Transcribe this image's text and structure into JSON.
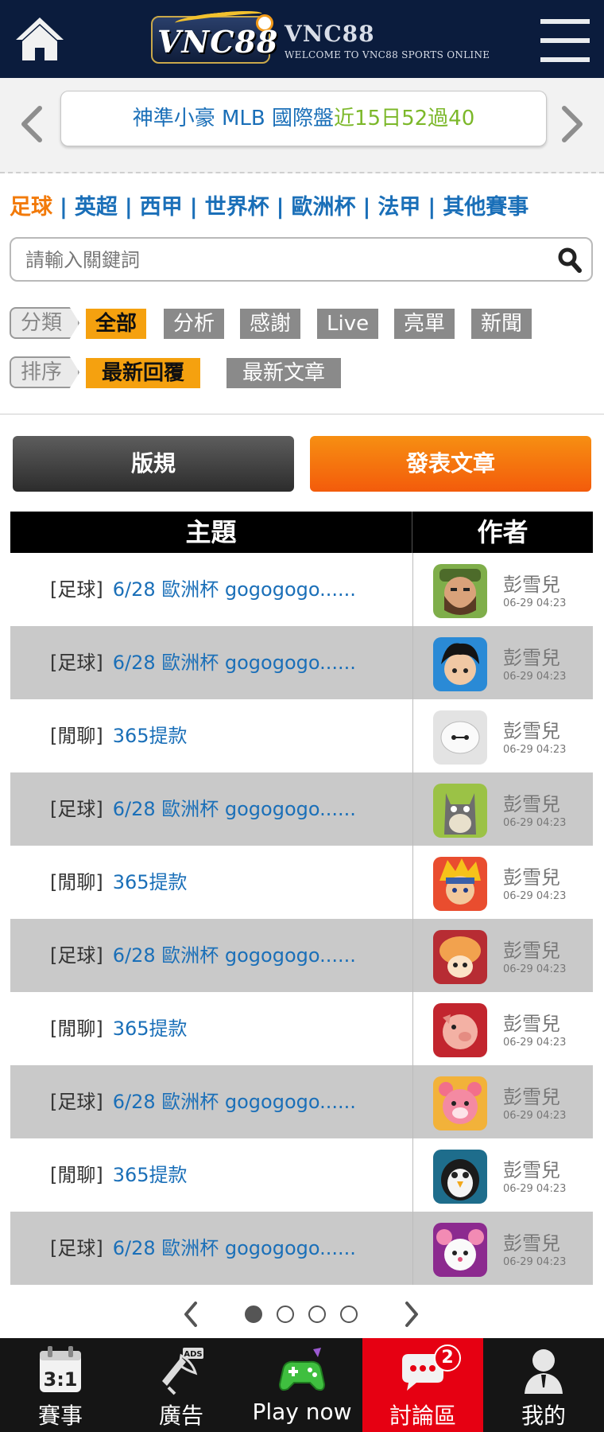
{
  "header": {
    "logo_text": "VNC88",
    "brand_name": "VNC88",
    "brand_tagline": "WELCOME TO VNC88 SPORTS ONLINE"
  },
  "marquee": {
    "part1": "神準小豪 MLB 國際盤",
    "part2": "近15日52過40"
  },
  "categories": [
    "足球",
    "英超",
    "西甲",
    "世界杯",
    "歐洲杯",
    "法甲",
    "其他賽事"
  ],
  "search": {
    "placeholder": "請輸入關鍵詞"
  },
  "filters": {
    "type_label": "分類",
    "type_options": [
      "全部",
      "分析",
      "感謝",
      "Live",
      "亮單",
      "新聞"
    ],
    "sort_label": "排序",
    "sort_options": [
      "最新回覆",
      "最新文章"
    ]
  },
  "buttons": {
    "rules": "版規",
    "post": "發表文章"
  },
  "table": {
    "headers": {
      "topic": "主題",
      "author": "作者"
    },
    "rows": [
      {
        "tag": "[足球]",
        "title": "6/28 歐洲杯 gogogogo......",
        "author": "彭雪兒",
        "date": "06-29 04:23",
        "avatar": "bearded-warrior"
      },
      {
        "tag": "[足球]",
        "title": "6/28 歐洲杯 gogogogo......",
        "author": "彭雪兒",
        "date": "06-29 04:23",
        "avatar": "black-hair-boy"
      },
      {
        "tag": "[閒聊]",
        "title": "365提款",
        "author": "彭雪兒",
        "date": "06-29 04:23",
        "avatar": "white-robot"
      },
      {
        "tag": "[足球]",
        "title": "6/28 歐洲杯 gogogogo......",
        "author": "彭雪兒",
        "date": "06-29 04:23",
        "avatar": "totoro"
      },
      {
        "tag": "[閒聊]",
        "title": "365提款",
        "author": "彭雪兒",
        "date": "06-29 04:23",
        "avatar": "ninja-boy"
      },
      {
        "tag": "[足球]",
        "title": "6/28 歐洲杯 gogogogo......",
        "author": "彭雪兒",
        "date": "06-29 04:23",
        "avatar": "mushroom"
      },
      {
        "tag": "[閒聊]",
        "title": "365提款",
        "author": "彭雪兒",
        "date": "06-29 04:23",
        "avatar": "pig"
      },
      {
        "tag": "[足球]",
        "title": "6/28 歐洲杯 gogogogo......",
        "author": "彭雪兒",
        "date": "06-29 04:23",
        "avatar": "pink-bear"
      },
      {
        "tag": "[閒聊]",
        "title": "365提款",
        "author": "彭雪兒",
        "date": "06-29 04:23",
        "avatar": "penguin"
      },
      {
        "tag": "[足球]",
        "title": "6/28 歐洲杯 gogogogo......",
        "author": "彭雪兒",
        "date": "06-29 04:23",
        "avatar": "white-mouse"
      }
    ]
  },
  "pagination": {
    "pages": 4,
    "current": 1
  },
  "bottom_nav": [
    {
      "label": "賽事",
      "icon": "calendar-score-icon",
      "icon_text": "3:1",
      "active": false
    },
    {
      "label": "廣告",
      "icon": "ads-icon",
      "icon_text": "ADS",
      "active": false
    },
    {
      "label": "Play now",
      "icon": "gamepad-icon",
      "active": false
    },
    {
      "label": "討論區",
      "icon": "chat-bubble-icon",
      "badge": "2",
      "active": true
    },
    {
      "label": "我的",
      "icon": "user-icon",
      "active": false
    }
  ],
  "colors": {
    "header_bg": "#0b1c3d",
    "accent_orange": "#f5a10f",
    "link_blue": "#1a6fb8",
    "active_red": "#e60012",
    "marquee_green": "#7cb82a"
  }
}
